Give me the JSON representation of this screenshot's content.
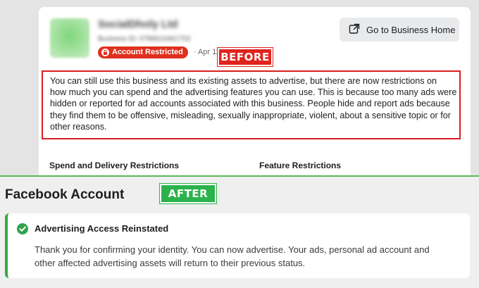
{
  "before": {
    "business_name": "SocialDholy Ltd",
    "business_id": "Business ID: 0786610461703",
    "badge_label": "Account Restricted",
    "status_date": "· Apr 11",
    "go_button_label": "Go to Business Home",
    "label": "BEFORE",
    "restriction_lines": [
      "You can still use this business and its existing assets to advertise, but there are now restrictions on",
      "how much you can spend and the advertising features you can use. This is because too many ads were",
      "hidden or reported for ad accounts associated with this business. People hide and report ads because",
      "they find them to be offensive, misleading, sexually inappropriate, violent, about a sensitive topic or for",
      "other reasons."
    ],
    "spend_heading": "Spend and Delivery Restrictions",
    "feature_heading": "Feature Restrictions"
  },
  "after": {
    "heading": "Facebook Account",
    "label": "AFTER",
    "card_title": "Advertising Access Reinstated",
    "card_lines": [
      "Thank you for confirming your identity. You can now advertise. Your ads, personal ad account and",
      "other affected advertising assets will return to their previous status."
    ]
  },
  "colors": {
    "restricted_red": "#e0301e",
    "before_label_red": "#e0241e",
    "after_label_green": "#2bb24c",
    "success_green": "#31a24c"
  },
  "icons": {
    "badge": "lock-icon",
    "go_button": "external-link-icon",
    "success": "check-circle-icon"
  }
}
